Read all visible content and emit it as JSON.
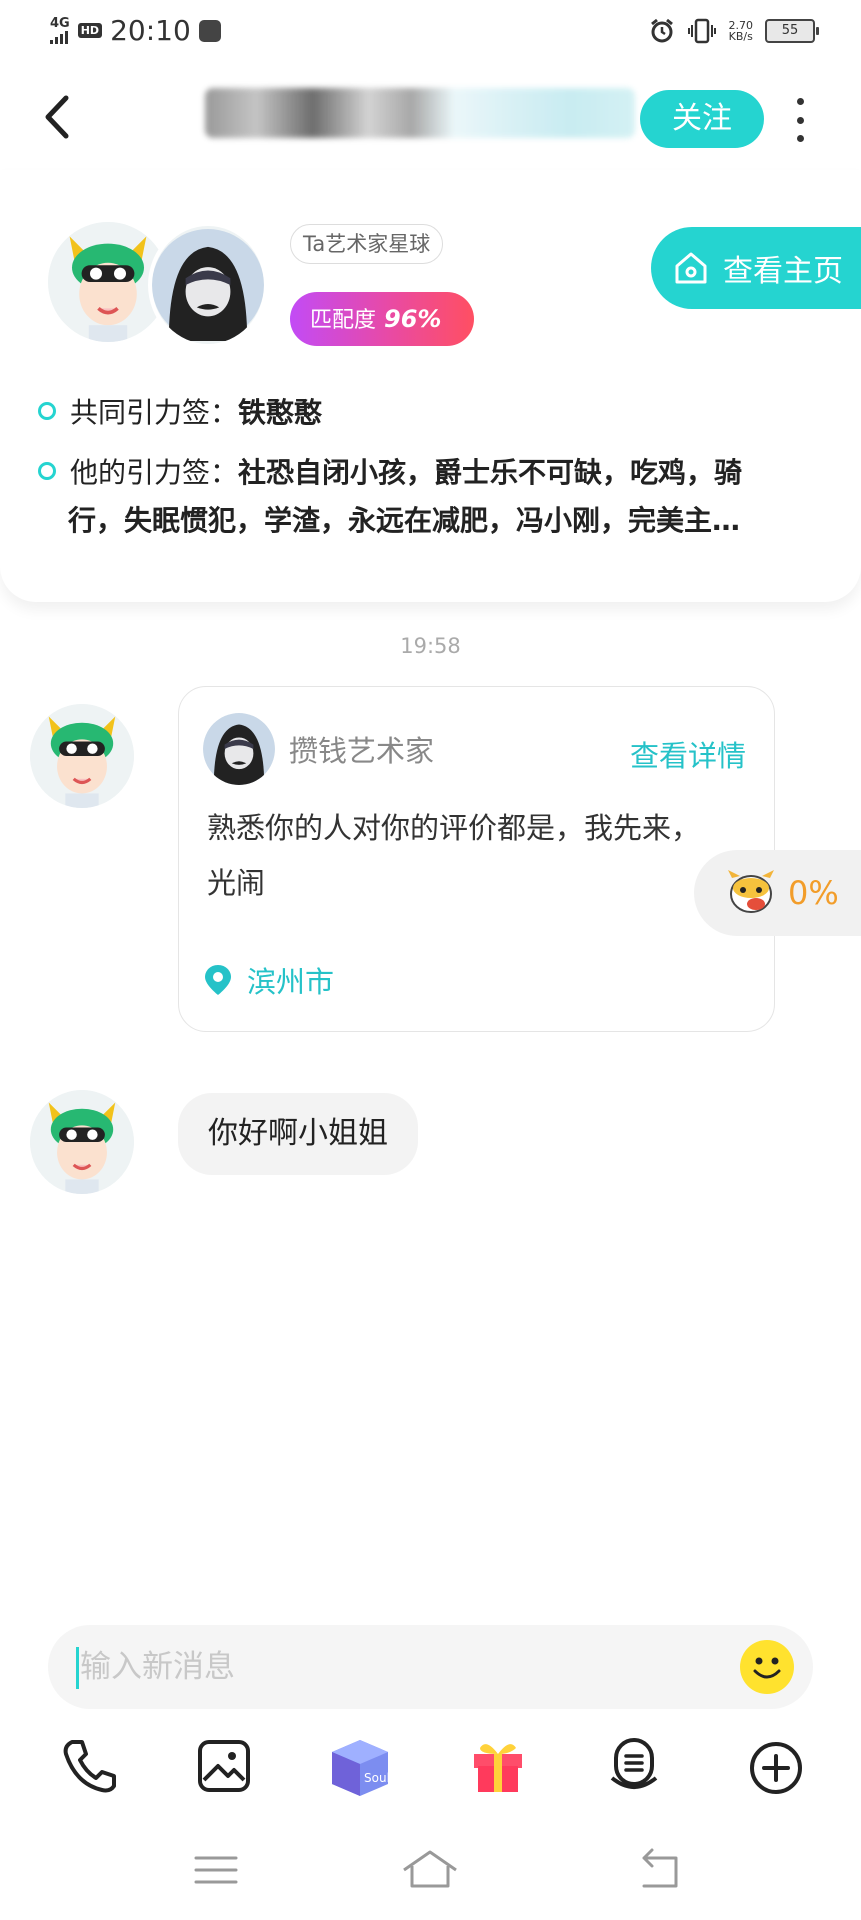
{
  "status_bar": {
    "network": "4G",
    "hd": "HD",
    "time": "20:10",
    "speed_value": "2.70",
    "speed_unit": "KB/s",
    "battery": "55"
  },
  "header": {
    "follow_label": "关注"
  },
  "profile": {
    "planet_tag": "Ta艺术家星球",
    "match_label": "匹配度",
    "match_value": "96%",
    "home_label": "查看主页",
    "common_tags_label": "共同引力签：",
    "common_tags_value": "铁憨憨",
    "his_tags_label": "他的引力签：",
    "his_tags_line1": "社恐自闭小孩，爵士乐不可缺，吃鸡，骑",
    "his_tags_line2": "行，失眠惯犯，学渣，永远在减肥，冯小刚，完美主…"
  },
  "chat": {
    "timestamp": "19:58",
    "card": {
      "author": "攒钱艺术家",
      "detail_label": "查看详情",
      "body": "熟悉你的人对你的评价都是，我先来，光闹",
      "location": "滨州市"
    },
    "message": "你好啊小姐姐",
    "float_percent": "0%"
  },
  "input": {
    "placeholder": "输入新消息"
  },
  "toolbar": {
    "soul_box_text": "Soul"
  },
  "colors": {
    "accent": "#25d4d0",
    "accent_text": "#25c2c8",
    "match_gradient_start": "#c24bf6",
    "match_gradient_end": "#ff4f62",
    "float_text": "#f29d2a"
  }
}
